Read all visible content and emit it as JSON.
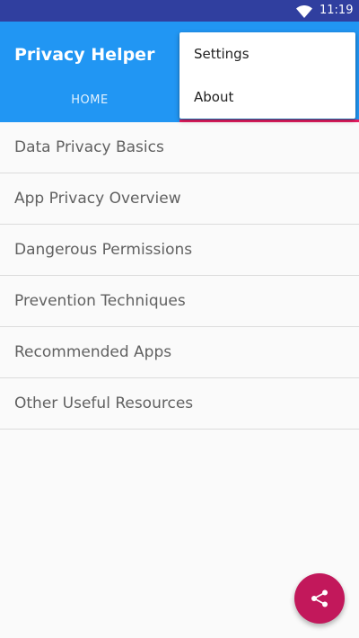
{
  "status_bar": {
    "time": "11:19",
    "icons": [
      "wifi-icon"
    ]
  },
  "app_bar": {
    "title": "Privacy Helper",
    "tabs": [
      {
        "label": "HOME",
        "selected": false
      }
    ],
    "colors": {
      "primary": "#2196f3",
      "status_bar": "#303f9f",
      "accent": "#e91e63"
    }
  },
  "overflow_menu": {
    "items": [
      {
        "label": "Settings"
      },
      {
        "label": "About"
      }
    ]
  },
  "topics": {
    "items": [
      {
        "label": "Data Privacy Basics"
      },
      {
        "label": "App Privacy Overview"
      },
      {
        "label": "Dangerous Permissions"
      },
      {
        "label": "Prevention Techniques"
      },
      {
        "label": "Recommended Apps"
      },
      {
        "label": "Other Useful Resources"
      }
    ]
  },
  "fab": {
    "icon": "share-icon",
    "color": "#c2185b"
  }
}
